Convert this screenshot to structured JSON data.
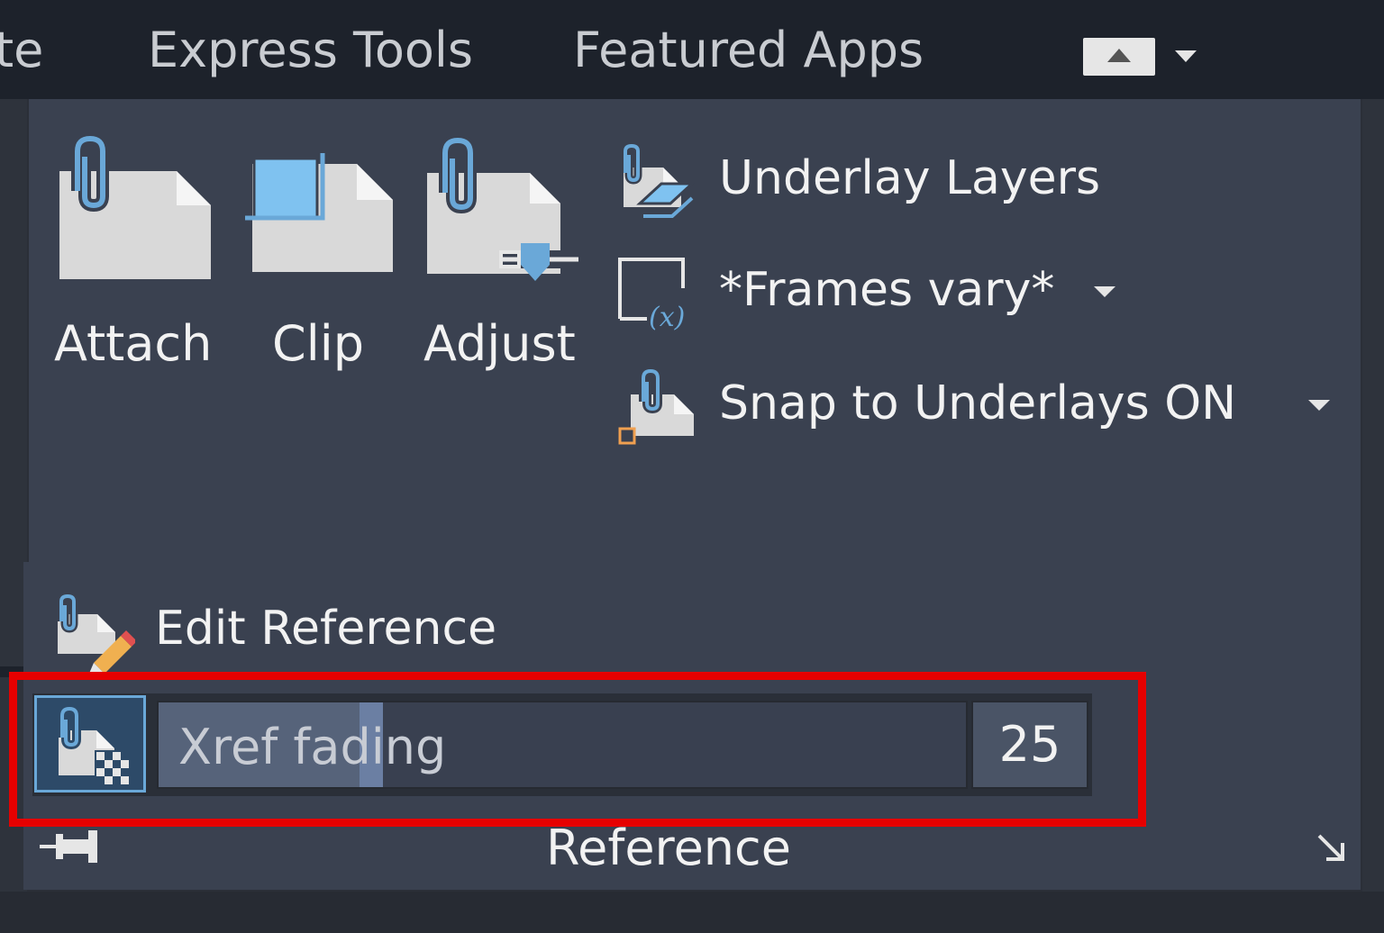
{
  "tabs": {
    "partial": "te",
    "express_tools": "Express Tools",
    "featured_apps": "Featured Apps"
  },
  "panel": {
    "title": "Reference",
    "large_buttons": [
      {
        "label": "Attach"
      },
      {
        "label": "Clip"
      },
      {
        "label": "Adjust"
      }
    ],
    "underlay_layers": "Underlay Layers",
    "frames": "*Frames vary*",
    "snap": "Snap to Underlays ON",
    "edit_reference": "Edit Reference",
    "xref_fading": {
      "label": "Xref fading",
      "value": "25",
      "percent": 25
    }
  },
  "colors": {
    "highlight": "#e60000",
    "accent_blue": "#6aa8d8",
    "panel_bg": "#3a4150"
  }
}
